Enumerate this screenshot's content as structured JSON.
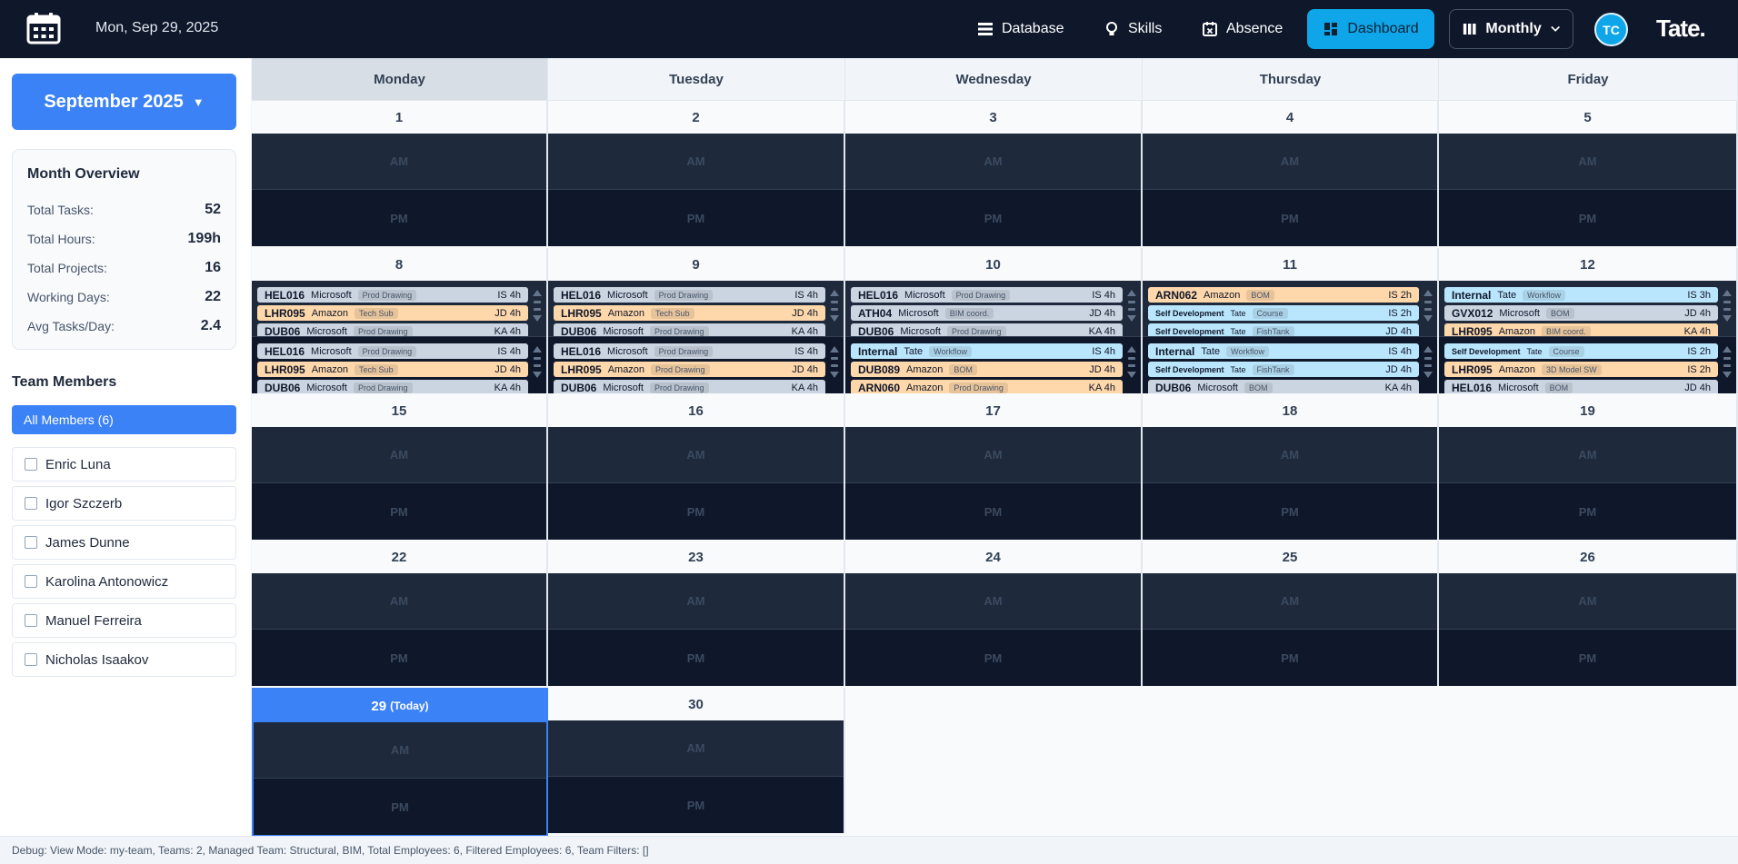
{
  "topbar": {
    "date": "Mon, Sep 29, 2025",
    "nav": {
      "database": "Database",
      "skills": "Skills",
      "absence": "Absence",
      "dashboard": "Dashboard"
    },
    "view_mode": "Monthly",
    "avatar_initials": "TC",
    "brand": "Tate."
  },
  "sidebar": {
    "month_label": "September 2025",
    "overview": {
      "title": "Month Overview",
      "rows": [
        {
          "label": "Total Tasks:",
          "value": "52"
        },
        {
          "label": "Total Hours:",
          "value": "199h"
        },
        {
          "label": "Total Projects:",
          "value": "16"
        },
        {
          "label": "Working Days:",
          "value": "22"
        },
        {
          "label": "Avg Tasks/Day:",
          "value": "2.4"
        }
      ]
    },
    "team_title": "Team Members",
    "all_members": "All Members (6)",
    "members": [
      "Enric Luna",
      "Igor Szczerb",
      "James Dunne",
      "Karolina Antonowicz",
      "Manuel Ferreira",
      "Nicholas Isaakov"
    ]
  },
  "calendar": {
    "weekdays": [
      "Monday",
      "Tuesday",
      "Wednesday",
      "Thursday",
      "Friday"
    ],
    "am_label": "AM",
    "pm_label": "PM",
    "today_label": "(Today)",
    "weeks": [
      [
        "1",
        "2",
        "3",
        "4",
        "5"
      ],
      [
        "8",
        "9",
        "10",
        "11",
        "12"
      ],
      [
        "15",
        "16",
        "17",
        "18",
        "19"
      ],
      [
        "22",
        "23",
        "24",
        "25",
        "26"
      ],
      [
        "29",
        "30"
      ]
    ],
    "week2_tasks": {
      "mon_am": [
        {
          "project": "HEL016",
          "client": "Microsoft",
          "tag": "Prod Drawing",
          "who": "IS 4h",
          "color": "gray"
        },
        {
          "project": "LHR095",
          "client": "Amazon",
          "tag": "Tech Sub",
          "who": "JD 4h",
          "color": "orange"
        },
        {
          "project": "DUB06",
          "client": "Microsoft",
          "tag": "Prod Drawing",
          "who": "KA 4h",
          "color": "gray"
        }
      ],
      "mon_pm": [
        {
          "project": "HEL016",
          "client": "Microsoft",
          "tag": "Prod Drawing",
          "who": "IS 4h",
          "color": "gray"
        },
        {
          "project": "LHR095",
          "client": "Amazon",
          "tag": "Tech Sub",
          "who": "JD 4h",
          "color": "orange"
        },
        {
          "project": "DUB06",
          "client": "Microsoft",
          "tag": "Prod Drawing",
          "who": "KA 4h",
          "color": "gray"
        }
      ],
      "tue_am": [
        {
          "project": "HEL016",
          "client": "Microsoft",
          "tag": "Prod Drawing",
          "who": "IS 4h",
          "color": "gray"
        },
        {
          "project": "LHR095",
          "client": "Amazon",
          "tag": "Tech Sub",
          "who": "JD 4h",
          "color": "orange"
        },
        {
          "project": "DUB06",
          "client": "Microsoft",
          "tag": "Prod Drawing",
          "who": "KA 4h",
          "color": "gray"
        }
      ],
      "tue_pm": [
        {
          "project": "HEL016",
          "client": "Microsoft",
          "tag": "Prod Drawing",
          "who": "IS 4h",
          "color": "gray"
        },
        {
          "project": "LHR095",
          "client": "Amazon",
          "tag": "Prod Drawing",
          "who": "JD 4h",
          "color": "orange"
        },
        {
          "project": "DUB06",
          "client": "Microsoft",
          "tag": "Prod Drawing",
          "who": "KA 4h",
          "color": "gray"
        }
      ],
      "wed_am": [
        {
          "project": "HEL016",
          "client": "Microsoft",
          "tag": "Prod Drawing",
          "who": "IS 4h",
          "color": "gray"
        },
        {
          "project": "ATH04",
          "client": "Microsoft",
          "tag": "BIM coord.",
          "who": "JD 4h",
          "color": "gray"
        },
        {
          "project": "DUB06",
          "client": "Microsoft",
          "tag": "Prod Drawing",
          "who": "KA 4h",
          "color": "gray"
        }
      ],
      "wed_pm": [
        {
          "project": "Internal",
          "client": "Tate",
          "tag": "Workflow",
          "who": "IS 4h",
          "color": "blue"
        },
        {
          "project": "DUB089",
          "client": "Amazon",
          "tag": "BOM",
          "who": "JD 4h",
          "color": "orange"
        },
        {
          "project": "ARN060",
          "client": "Amazon",
          "tag": "Prod Drawing",
          "who": "KA 4h",
          "color": "orange"
        }
      ],
      "thu_am": [
        {
          "project": "ARN062",
          "client": "Amazon",
          "tag": "BOM",
          "who": "IS 2h",
          "color": "orange"
        },
        {
          "project": "Self Development",
          "client": "Tate",
          "tag": "Course",
          "who": "IS 2h",
          "color": "blue",
          "small": true
        },
        {
          "project": "Self Development",
          "client": "Tate",
          "tag": "FishTank",
          "who": "JD 4h",
          "color": "blue",
          "small": true
        }
      ],
      "thu_pm": [
        {
          "project": "Internal",
          "client": "Tate",
          "tag": "Workflow",
          "who": "IS 4h",
          "color": "blue"
        },
        {
          "project": "Self Development",
          "client": "Tate",
          "tag": "FishTank",
          "who": "JD 4h",
          "color": "blue",
          "small": true
        },
        {
          "project": "DUB06",
          "client": "Microsoft",
          "tag": "BOM",
          "who": "KA 4h",
          "color": "gray"
        }
      ],
      "fri_am": [
        {
          "project": "Internal",
          "client": "Tate",
          "tag": "Workflow",
          "who": "IS 3h",
          "color": "blue"
        },
        {
          "project": "GVX012",
          "client": "Microsoft",
          "tag": "BOM",
          "who": "JD 4h",
          "color": "gray"
        },
        {
          "project": "LHR095",
          "client": "Amazon",
          "tag": "BIM coord.",
          "who": "KA 4h",
          "color": "orange"
        }
      ],
      "fri_pm": [
        {
          "project": "Self Development",
          "client": "Tate",
          "tag": "Course",
          "who": "IS 2h",
          "color": "blue",
          "small": true
        },
        {
          "project": "LHR095",
          "client": "Amazon",
          "tag": "3D Model SW",
          "who": "IS 2h",
          "color": "orange"
        },
        {
          "project": "HEL016",
          "client": "Microsoft",
          "tag": "BOM",
          "who": "JD 4h",
          "color": "gray"
        }
      ]
    }
  },
  "debug": "Debug: View Mode: my-team, Teams: 2, Managed Team: Structural, BIM, Total Employees: 6, Filtered Employees: 6, Team Filters: []"
}
